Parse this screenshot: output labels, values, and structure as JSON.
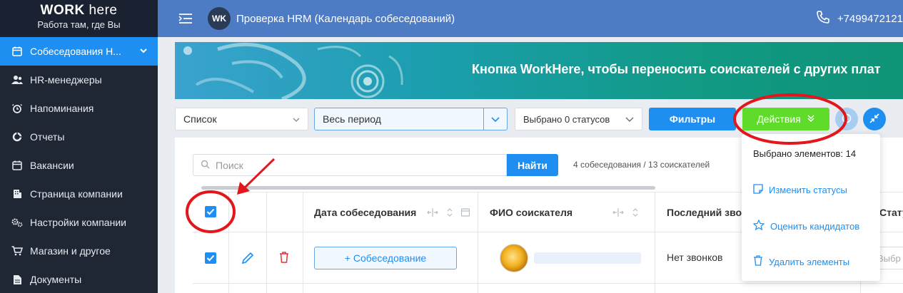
{
  "brand": {
    "name_bold": "WORK",
    "name_light": " here",
    "tagline": "Работа там, где Вы"
  },
  "sidebar": {
    "items": [
      {
        "label": "Собеседования Н...",
        "icon": "calendar-icon",
        "active": true
      },
      {
        "label": "HR-менеджеры",
        "icon": "users-icon"
      },
      {
        "label": "Напоминания",
        "icon": "alarm-icon"
      },
      {
        "label": "Отчеты",
        "icon": "chart-pie-icon"
      },
      {
        "label": "Вакансии",
        "icon": "calendar-icon"
      },
      {
        "label": "Страница компании",
        "icon": "building-icon"
      },
      {
        "label": "Настройки компании",
        "icon": "gears-icon"
      },
      {
        "label": "Магазин и другое",
        "icon": "cart-icon"
      },
      {
        "label": "Документы",
        "icon": "document-icon"
      }
    ]
  },
  "topbar": {
    "avatar_text": "WK",
    "title": "Проверка HRM (Календарь собеседований)",
    "phone": "+7499472121"
  },
  "banner": {
    "text": "Кнопка WorkHere, чтобы переносить соискателей с других плат"
  },
  "controls": {
    "view": "Список",
    "period": "Весь период",
    "statuses": "Выбрано 0 статусов",
    "filters": "Фильтры",
    "actions": "Действия"
  },
  "search": {
    "placeholder": "Поиск",
    "button": "Найти",
    "counts": "4 собеседования / 13 соискателей"
  },
  "table": {
    "headers": [
      "Дата собеседования",
      "ФИО соискателя",
      "Последний звон",
      "Статус"
    ],
    "row": {
      "add_button": "+ Собеседование",
      "calls": "Нет звонков",
      "status_placeholder": "Выбр"
    }
  },
  "dropdown": {
    "selected": "Выбрано элементов: 14",
    "items": [
      {
        "label": "Изменить статусы",
        "icon": "note-edit-icon"
      },
      {
        "label": "Оценить кандидатов",
        "icon": "star-icon"
      },
      {
        "label": "Удалить элементы",
        "icon": "trash-icon"
      }
    ]
  },
  "colors": {
    "accent": "#1e8ff1",
    "actions_green": "#5fdc2a",
    "sidebar_bg": "#1f2634",
    "topbar_bg": "#4d7cc4",
    "annotation_red": "#e3161b"
  }
}
